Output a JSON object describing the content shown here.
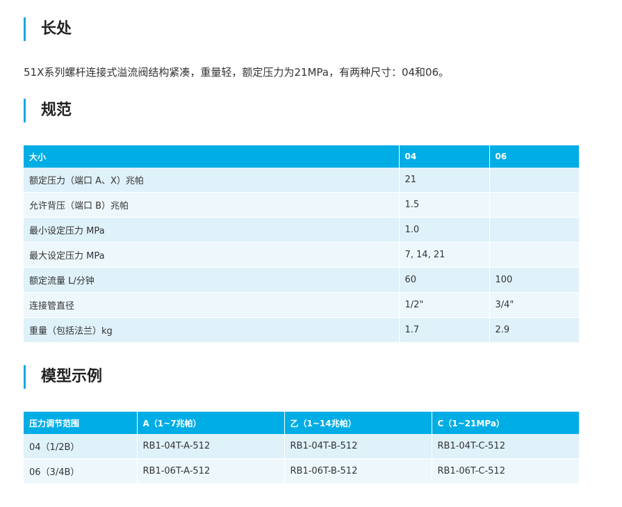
{
  "section1": {
    "title": "长处",
    "text": "51X系列螺杆连接式溢流阀结构紧凑，重量轻，额定压力为21MPa，有两种尺寸：04和06。"
  },
  "section2": {
    "title": "规范",
    "table": {
      "headers": [
        "大小",
        "04",
        "06"
      ],
      "rows": [
        [
          "额定压力（端口 A、X）兆帕",
          "21",
          ""
        ],
        [
          "允许背压（端口 B）兆帕",
          "1.5",
          ""
        ],
        [
          "最小设定压力 MPa",
          "1.0",
          ""
        ],
        [
          "最大设定压力 MPa",
          "7, 14, 21",
          ""
        ],
        [
          "额定流量 L/分钟",
          "60",
          "100"
        ],
        [
          "连接管直径",
          "1/2\"",
          "3/4\""
        ],
        [
          "重量（包括法兰）kg",
          "1.7",
          "2.9"
        ]
      ]
    }
  },
  "section3": {
    "title": "模型示例",
    "table": {
      "headers": [
        "压力调节范围",
        "A（1~7兆帕）",
        "乙（1~14兆帕）",
        "C（1~21MPa）"
      ],
      "rows": [
        [
          "04（1/2B）",
          "RB1-04T-A-512",
          "RB1-04T-B-512",
          "RB1-04T-C-512"
        ],
        [
          "06（3/4B）",
          "RB1-06T-A-512",
          "RB1-06T-B-512",
          "RB1-06T-C-512"
        ]
      ]
    }
  }
}
